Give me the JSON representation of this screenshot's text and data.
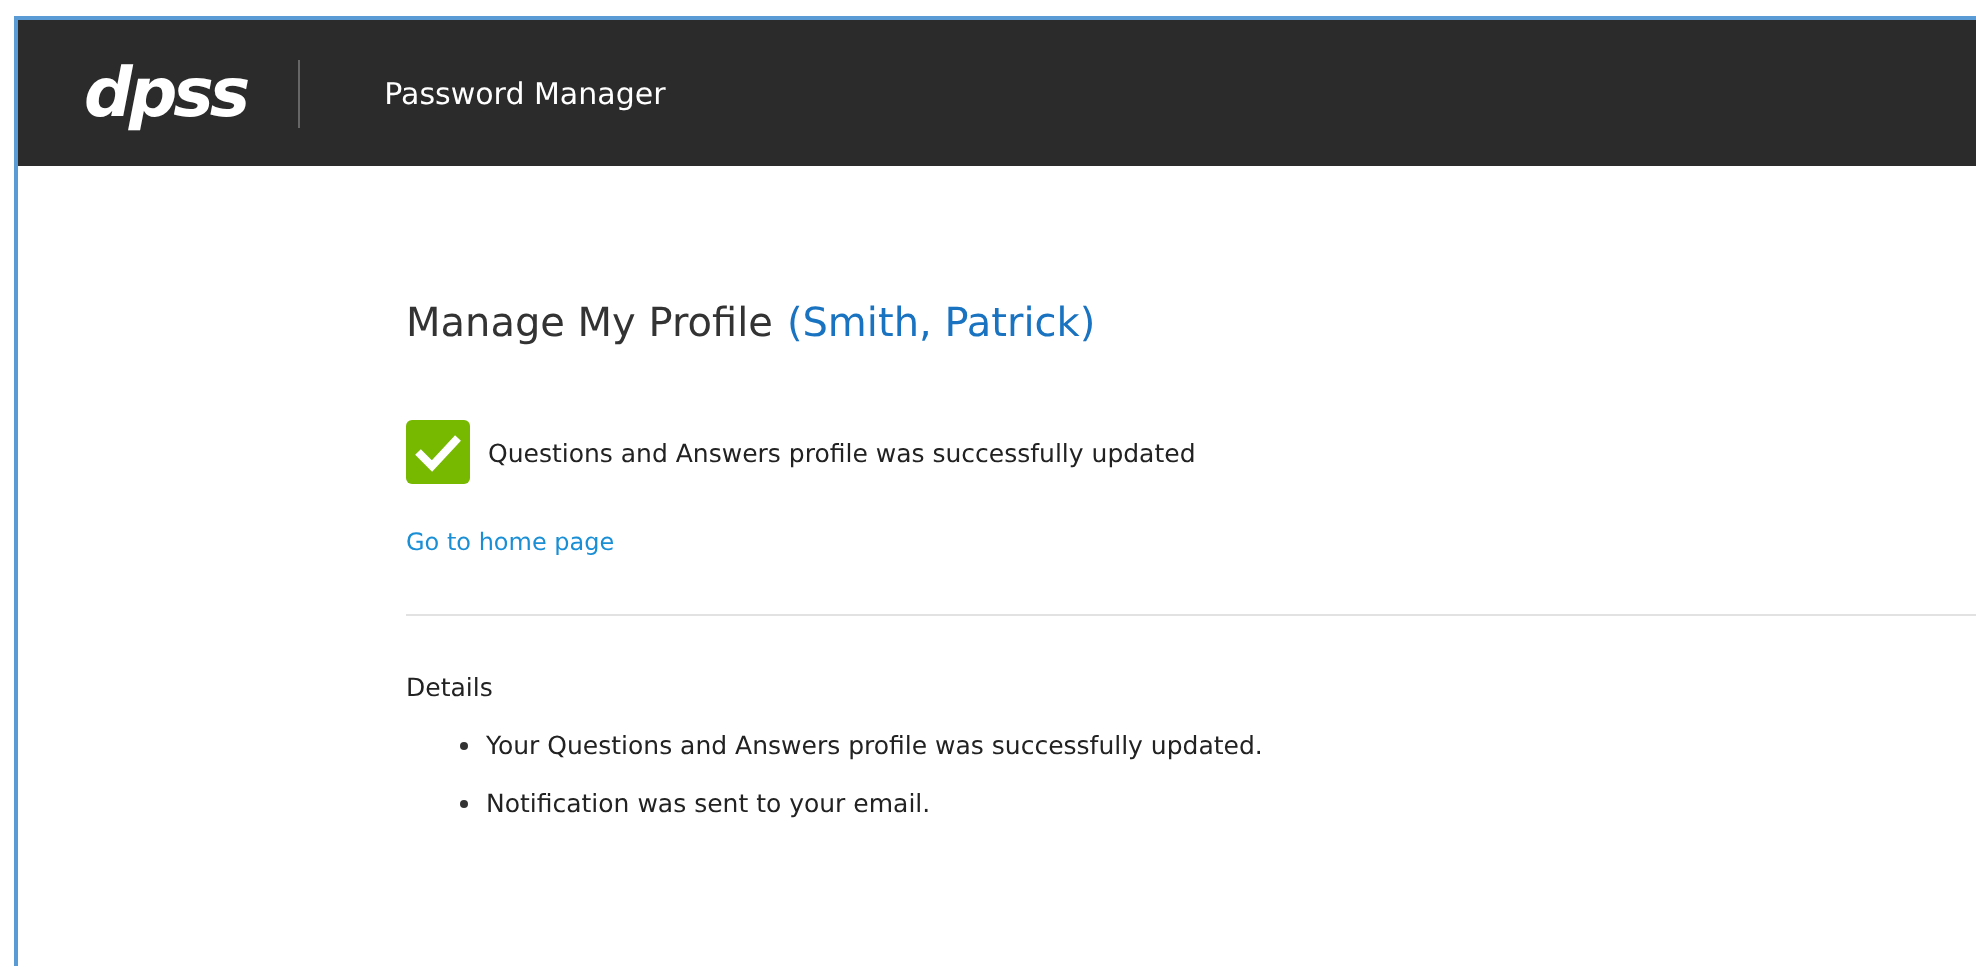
{
  "header": {
    "logo": "dpss",
    "title": "Password Manager"
  },
  "page": {
    "heading": "Manage My Profile",
    "user": "(Smith, Patrick)"
  },
  "status": {
    "success": true,
    "message": "Questions and Answers profile was successfully updated"
  },
  "home_link": "Go to home page",
  "details": {
    "title": "Details",
    "items": [
      "Your Questions and Answers profile was successfully updated.",
      "Notification was sent to your email."
    ]
  }
}
